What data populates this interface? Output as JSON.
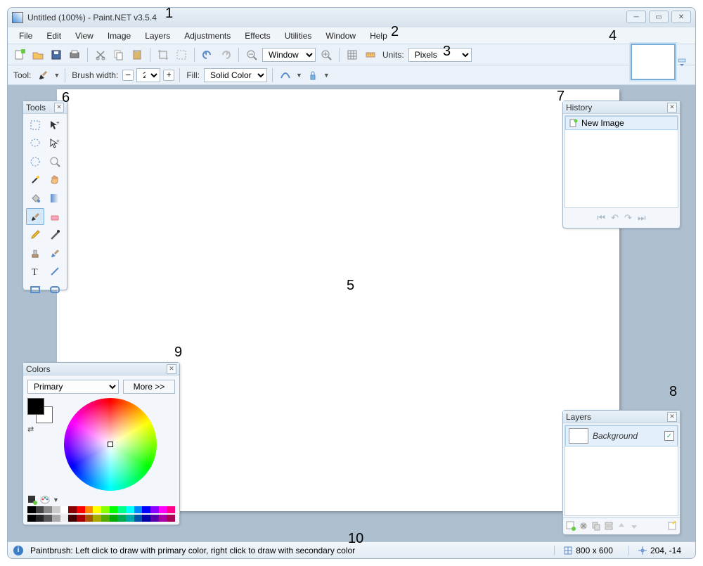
{
  "title": "Untitled (100%) - Paint.NET v3.5.4",
  "menus": [
    "File",
    "Edit",
    "View",
    "Image",
    "Layers",
    "Adjustments",
    "Effects",
    "Utilities",
    "Window",
    "Help"
  ],
  "toolbar": {
    "zoom_mode": "Window",
    "units_label": "Units:",
    "units_value": "Pixels"
  },
  "toolbar2": {
    "tool_label": "Tool:",
    "brush_width_label": "Brush width:",
    "brush_width_value": "2",
    "fill_label": "Fill:",
    "fill_value": "Solid Color"
  },
  "panels": {
    "tools": {
      "title": "Tools"
    },
    "history": {
      "title": "History",
      "items": [
        "New Image"
      ]
    },
    "layers": {
      "title": "Layers",
      "items": [
        {
          "name": "Background",
          "checked": true
        }
      ]
    },
    "colors": {
      "title": "Colors",
      "selector": "Primary",
      "more_label": "More >>"
    }
  },
  "status": {
    "hint": "Paintbrush: Left click to draw with primary color, right click to draw with secondary color",
    "dimensions": "800 x 600",
    "cursor": "204, -14"
  },
  "annotations": [
    "1",
    "2",
    "3",
    "4",
    "5",
    "6",
    "7",
    "8",
    "9",
    "10"
  ]
}
